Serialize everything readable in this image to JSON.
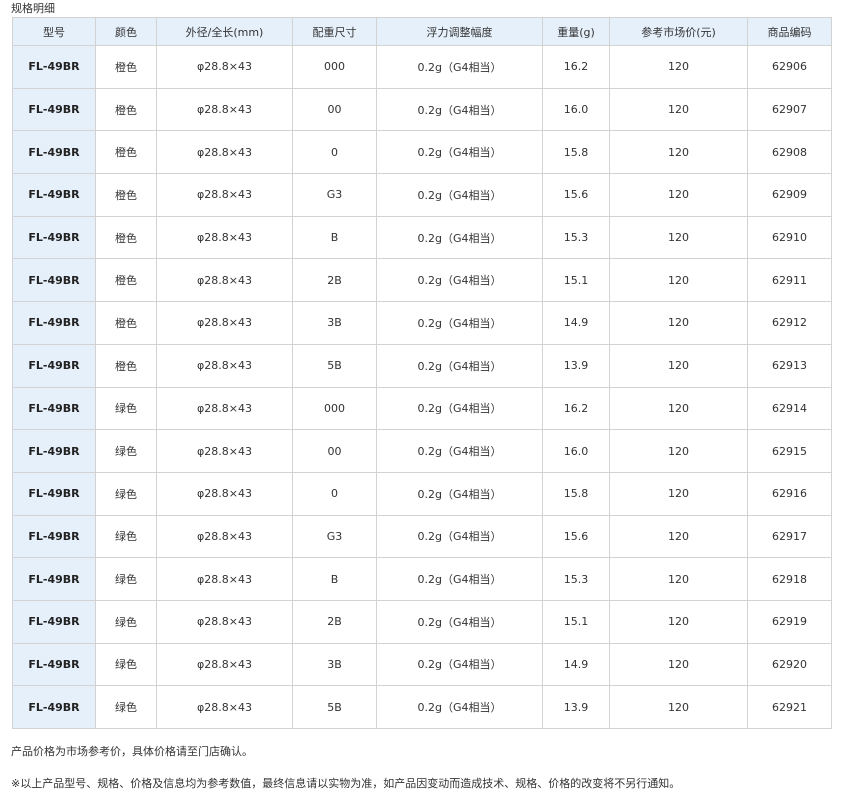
{
  "section_title": "规格明细",
  "table": {
    "headers": [
      "型号",
      "颜色",
      "外径/全长(mm)",
      "配重尺寸",
      "浮力调整幅度",
      "重量(g)",
      "参考市场价(元)",
      "商品编码"
    ],
    "rows": [
      [
        "FL-49BR",
        "橙色",
        "φ28.8×43",
        "000",
        "0.2g（G4相当）",
        "16.2",
        "120",
        "62906"
      ],
      [
        "FL-49BR",
        "橙色",
        "φ28.8×43",
        "00",
        "0.2g（G4相当）",
        "16.0",
        "120",
        "62907"
      ],
      [
        "FL-49BR",
        "橙色",
        "φ28.8×43",
        "0",
        "0.2g（G4相当）",
        "15.8",
        "120",
        "62908"
      ],
      [
        "FL-49BR",
        "橙色",
        "φ28.8×43",
        "G3",
        "0.2g（G4相当）",
        "15.6",
        "120",
        "62909"
      ],
      [
        "FL-49BR",
        "橙色",
        "φ28.8×43",
        "B",
        "0.2g（G4相当）",
        "15.3",
        "120",
        "62910"
      ],
      [
        "FL-49BR",
        "橙色",
        "φ28.8×43",
        "2B",
        "0.2g（G4相当）",
        "15.1",
        "120",
        "62911"
      ],
      [
        "FL-49BR",
        "橙色",
        "φ28.8×43",
        "3B",
        "0.2g（G4相当）",
        "14.9",
        "120",
        "62912"
      ],
      [
        "FL-49BR",
        "橙色",
        "φ28.8×43",
        "5B",
        "0.2g（G4相当）",
        "13.9",
        "120",
        "62913"
      ],
      [
        "FL-49BR",
        "绿色",
        "φ28.8×43",
        "000",
        "0.2g（G4相当）",
        "16.2",
        "120",
        "62914"
      ],
      [
        "FL-49BR",
        "绿色",
        "φ28.8×43",
        "00",
        "0.2g（G4相当）",
        "16.0",
        "120",
        "62915"
      ],
      [
        "FL-49BR",
        "绿色",
        "φ28.8×43",
        "0",
        "0.2g（G4相当）",
        "15.8",
        "120",
        "62916"
      ],
      [
        "FL-49BR",
        "绿色",
        "φ28.8×43",
        "G3",
        "0.2g（G4相当）",
        "15.6",
        "120",
        "62917"
      ],
      [
        "FL-49BR",
        "绿色",
        "φ28.8×43",
        "B",
        "0.2g（G4相当）",
        "15.3",
        "120",
        "62918"
      ],
      [
        "FL-49BR",
        "绿色",
        "φ28.8×43",
        "2B",
        "0.2g（G4相当）",
        "15.1",
        "120",
        "62919"
      ],
      [
        "FL-49BR",
        "绿色",
        "φ28.8×43",
        "3B",
        "0.2g（G4相当）",
        "14.9",
        "120",
        "62920"
      ],
      [
        "FL-49BR",
        "绿色",
        "φ28.8×43",
        "5B",
        "0.2g（G4相当）",
        "13.9",
        "120",
        "62921"
      ]
    ]
  },
  "notes": [
    "产品价格为市场参考价，具体价格请至门店确认。",
    "※以上产品型号、规格、价格及信息均为参考数值，最终信息请以实物为准，如产品因变动而造成技术、规格、价格的改变将不另行通知。"
  ],
  "colors": {
    "header_bg": "#e6f0fb",
    "border": "#d3d3d3",
    "text": "#333333"
  }
}
